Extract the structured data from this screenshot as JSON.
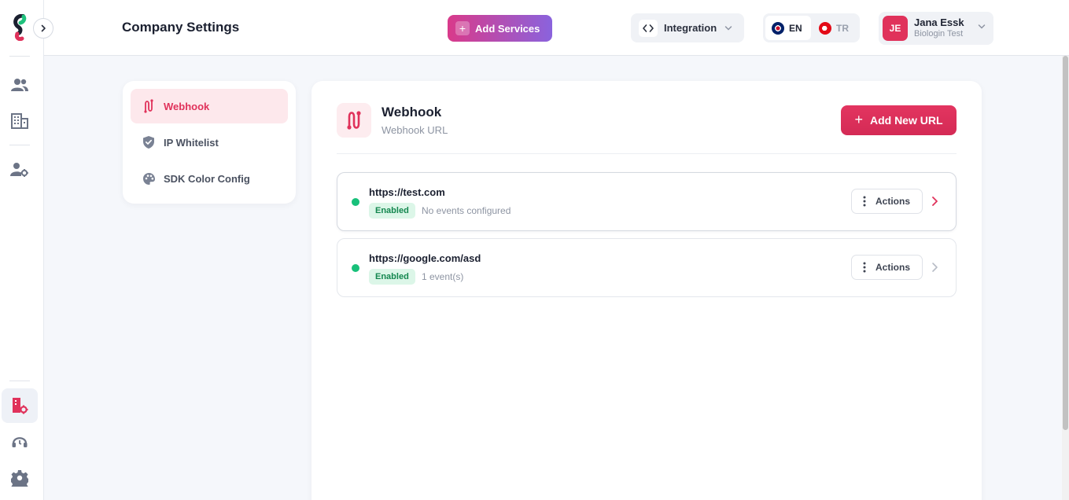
{
  "header": {
    "title": "Company Settings",
    "add_services_label": "Add Services",
    "integration_label": "Integration",
    "languages": [
      {
        "code": "EN",
        "active": true
      },
      {
        "code": "TR",
        "active": false
      }
    ],
    "user": {
      "initials": "JE",
      "name": "Jana Essk",
      "org": "Biologin Test"
    }
  },
  "rail": {
    "icons": [
      "logo-icon",
      "users-icon",
      "building-icon",
      "user-settings-icon",
      "company-settings-icon",
      "support-icon",
      "settings-icon"
    ]
  },
  "settings_nav": {
    "items": [
      {
        "label": "Webhook",
        "icon": "webhook-icon",
        "active": true
      },
      {
        "label": "IP Whitelist",
        "icon": "shield-check-icon",
        "active": false
      },
      {
        "label": "SDK Color Config",
        "icon": "palette-icon",
        "active": false
      }
    ]
  },
  "main": {
    "title": "Webhook",
    "subtitle": "Webhook URL",
    "add_url_label": "Add New URL",
    "webhooks": [
      {
        "url": "https://test.com",
        "status": "Enabled",
        "events": "No events configured",
        "actions_label": "Actions"
      },
      {
        "url": "https://google.com/asd",
        "status": "Enabled",
        "events": "1 event(s)",
        "actions_label": "Actions"
      }
    ]
  },
  "colors": {
    "accent": "#e0325b",
    "status_green": "#18c07a",
    "gradient_start": "#d93a8a",
    "gradient_end": "#8a63dd"
  }
}
